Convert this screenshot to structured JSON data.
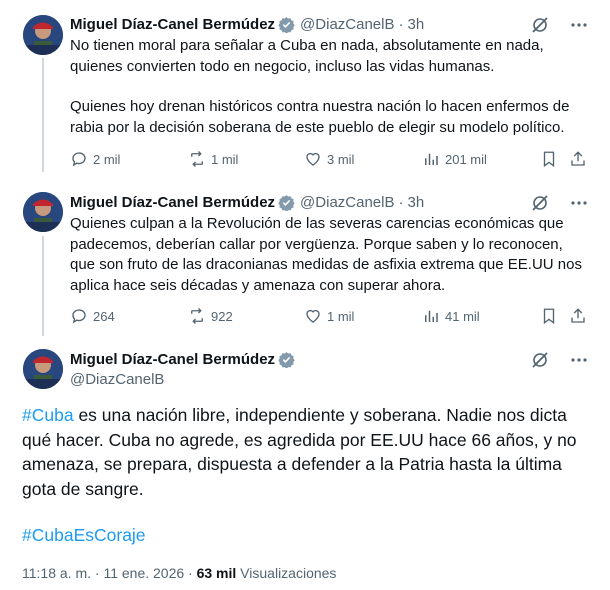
{
  "author": {
    "name": "Miguel Díaz-Canel Bermúdez",
    "handle": "@DiazCanelB"
  },
  "colors": {
    "accent": "#1d9bf0",
    "muted": "#536471",
    "text": "#0f1419"
  },
  "icons": [
    "verified-badge-icon",
    "grok-icon",
    "more-icon",
    "reply-icon",
    "retweet-icon",
    "like-icon",
    "views-icon",
    "bookmark-icon",
    "share-icon"
  ],
  "tweets": [
    {
      "time": "3h",
      "paragraphs": [
        "No tienen moral para señalar a Cuba en nada, absolutamente en nada, quienes convierten todo en negocio, incluso las vidas humanas.",
        "Quienes hoy drenan históricos contra nuestra nación lo hacen enfermos de rabia por la decisión soberana de este pueblo de elegir su modelo político."
      ],
      "replies": "2 mil",
      "retweets": "1 mil",
      "likes": "3 mil",
      "views": "201 mil"
    },
    {
      "time": "3h",
      "paragraphs": [
        "Quienes culpan a la Revolución de las severas carencias económicas que padecemos, deberían callar por vergüenza. Porque saben y lo reconocen, que son fruto de las draconianas medidas de asfixia extrema que EE.UU nos aplica hace seis décadas y amenaza con superar ahora."
      ],
      "replies": "264",
      "retweets": "922",
      "likes": "1 mil",
      "views": "41 mil"
    }
  ],
  "main_tweet": {
    "hashtag1": "#Cuba",
    "text": " es una nación libre, independiente y soberana. Nadie nos dicta qué hacer. Cuba no agrede, es agredida por EE.UU hace 66 años, y no amenaza, se prepara, dispuesta a defender a la Patria hasta la última gota de sangre.",
    "hashtag2": "#CubaEsCoraje",
    "timestamp": "11:18 a. m. · 11 ene. 2026 · ",
    "views_count": "63 mil",
    "views_label": " Visualizaciones"
  }
}
